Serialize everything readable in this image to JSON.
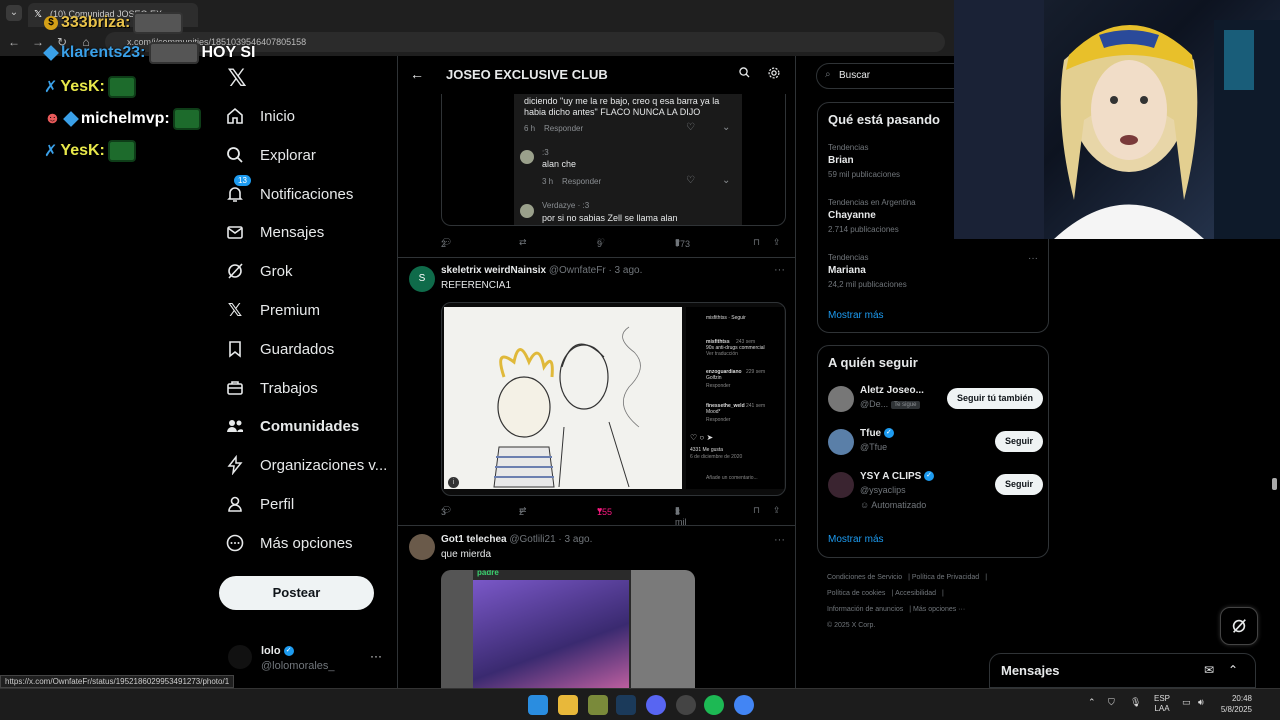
{
  "browser": {
    "tab_title": "(10) Comunidad JOSEO EX...",
    "url": "x.com/i/communities/1851039546407805158",
    "status_url": "https://x.com/OwnfateFr/status/1952186029953491273/photo/1"
  },
  "stream_chat": [
    {
      "name": "333briza:",
      "color": "#e8c24a",
      "message": ""
    },
    {
      "name": "klarents23:",
      "color": "#3aa0e8",
      "message": "HOY SI"
    },
    {
      "name": "YesK:",
      "color": "#e8e84a",
      "message": ""
    },
    {
      "name": "michelmvp:",
      "color": "#ffffff",
      "message": ""
    },
    {
      "name": "YesK:",
      "color": "#e8e84a",
      "message": ""
    }
  ],
  "sidebar": {
    "items": [
      {
        "label": "Inicio",
        "icon": "home-icon"
      },
      {
        "label": "Explorar",
        "icon": "search-icon"
      },
      {
        "label": "Notificaciones",
        "icon": "bell-icon",
        "badge": "13"
      },
      {
        "label": "Mensajes",
        "icon": "mail-icon"
      },
      {
        "label": "Grok",
        "icon": "grok-icon"
      },
      {
        "label": "Premium",
        "icon": "x-icon"
      },
      {
        "label": "Guardados",
        "icon": "bookmark-icon"
      },
      {
        "label": "Trabajos",
        "icon": "briefcase-icon"
      },
      {
        "label": "Comunidades",
        "icon": "people-icon",
        "active": true
      },
      {
        "label": "Organizaciones v...",
        "icon": "bolt-icon"
      },
      {
        "label": "Perfil",
        "icon": "person-icon"
      },
      {
        "label": "Más opciones",
        "icon": "more-circle-icon"
      }
    ],
    "post_label": "Postear",
    "account": {
      "name": "lolo",
      "handle": "@lolomorales_"
    }
  },
  "main": {
    "header_title": "JOSEO EXCLUSIVE CLUB",
    "embed": {
      "text1": "diciendo \"uy me la re bajo, creo q esa barra ya la habia dicho antes\" FLACO NUNCA LA DIJO",
      "meta1_time": "6 h",
      "meta1_reply": "Responder",
      "c2_user": ":3",
      "c2_text": "alan che",
      "c2_time": "3 h",
      "c2_reply": "Responder",
      "c3_user": "Verdazye · :3",
      "c3_text": "por si no sabias Zell se llama alan"
    },
    "post0_actions": {
      "replies": "2",
      "likes": "9",
      "views": "773"
    },
    "post1": {
      "name": "skeletrix weirdNainsix",
      "handle": "@OwnfateFr · 3 ago.",
      "text": "REFERENCIA1",
      "replies": "3",
      "reposts": "2",
      "likes": "155",
      "views": "3 mil",
      "ig": {
        "account": "misfithtss · Seguir",
        "c1_user": "misfithtss",
        "c1_time": "243 sem",
        "c1_text": "90s anti-drugs commercial",
        "c1_sub": "Ver traducción",
        "c2_user": "enzoguardiano",
        "c2_time": "229 sem",
        "c2_text": "Golfzin",
        "c2_sub": "Responder",
        "c3_user": "finessethe_weld",
        "c3_time": "241 sem",
        "c3_text": "Mood*",
        "c3_sub": "Responder",
        "likes": "4331 Me gusta",
        "date": "6 de diciembre de 2020",
        "comment_placeholder": "Añade un comentario..."
      }
    },
    "post2": {
      "name": "Got1 telechea",
      "handle": "@Gotlili21 · 3 ago.",
      "text": "que mierda",
      "media_label": "padre"
    }
  },
  "right": {
    "search_placeholder": "Buscar",
    "trends_title": "Qué está pasando",
    "trends": [
      {
        "category": "Tendencias",
        "name": "Brian",
        "count": "59 mil publicaciones"
      },
      {
        "category": "Tendencias en Argentina",
        "name": "Chayanne",
        "count": "2.714 publicaciones"
      },
      {
        "category": "Tendencias",
        "name": "Mariana",
        "count": "24,2 mil publicaciones"
      }
    ],
    "show_more": "Mostrar más",
    "follow_title": "A quién seguir",
    "follow": [
      {
        "name": "Aletz Joseo...",
        "handle": "@De...",
        "tag": "Te sigue",
        "button": "Seguir tú también",
        "verified": false
      },
      {
        "name": "Tfue",
        "handle": "@Tfue",
        "button": "Seguir",
        "verified": true
      },
      {
        "name": "YSY A CLIPS",
        "handle": "@ysyaclips",
        "extra": "Automatizado",
        "button": "Seguir",
        "verified": true
      }
    ],
    "follow_more": "Mostrar más",
    "footer": [
      "Condiciones de Servicio",
      "Política de Privacidad",
      "Política de cookies",
      "Accesibilidad",
      "Información de anuncios",
      "Más opciones ···",
      "© 2025 X Corp."
    ]
  },
  "messages_bar": {
    "title": "Mensajes"
  },
  "taskbar": {
    "lang_top": "ESP",
    "lang_bottom": "LAA",
    "time": "20:48",
    "date": "5/8/2025"
  }
}
